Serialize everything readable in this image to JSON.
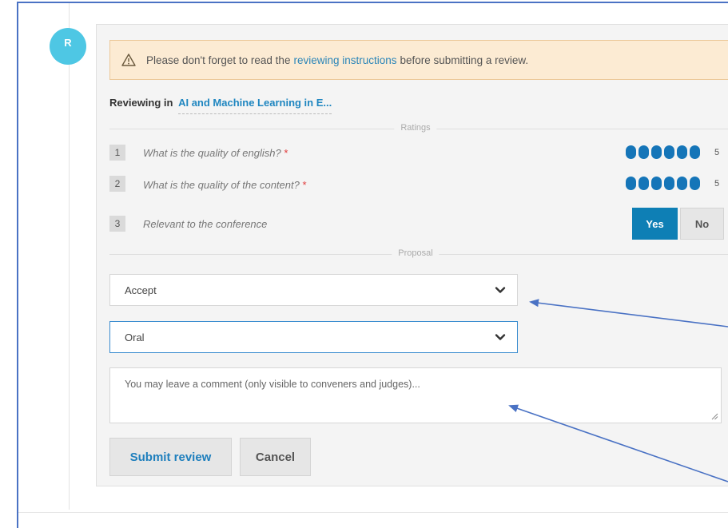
{
  "reviewer": {
    "initial": "R"
  },
  "notice": {
    "prefix": "Please don't forget to read the",
    "link": "reviewing instructions",
    "suffix": "before submitting a review."
  },
  "reviewing": {
    "label": "Reviewing in",
    "track": "AI and Machine Learning in E..."
  },
  "sections": {
    "ratings": "Ratings",
    "proposal": "Proposal"
  },
  "questions": [
    {
      "num": "1",
      "text": "What is the quality of english?",
      "required": "*",
      "rating": 5,
      "rating_text": "5"
    },
    {
      "num": "2",
      "text": "What is the quality of the content?",
      "required": "*",
      "rating": 5,
      "rating_text": "5"
    },
    {
      "num": "3",
      "text": "Relevant to the conference",
      "yes": "Yes",
      "no": "No",
      "selected": "Yes"
    }
  ],
  "proposal": {
    "decision_value": "Accept",
    "type_value": "Oral"
  },
  "comment": {
    "placeholder": "You may leave a comment (only visible to conveners and judges)..."
  },
  "actions": {
    "submit": "Submit review",
    "cancel": "Cancel"
  },
  "colors": {
    "accent": "#0e7fb5",
    "avatar": "#4ec7e4",
    "warning_bg": "#fcebd3",
    "annotation_arrow": "#4a72c4",
    "required": "#e03a3a"
  }
}
